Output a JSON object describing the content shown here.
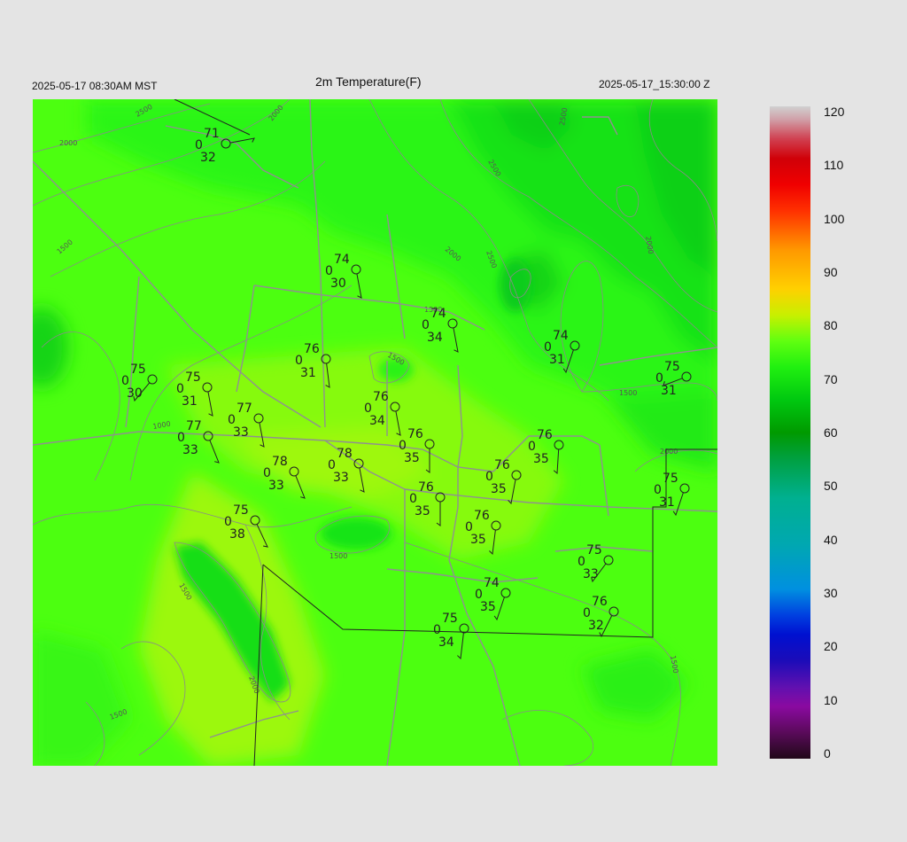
{
  "header": {
    "local_time": "2025-05-17 08:30AM MST",
    "title": "2m Temperature(F)",
    "utc_time": "2025-05-17_15:30:00 Z"
  },
  "colorbar": {
    "labels": [
      "120",
      "110",
      "100",
      "90",
      "80",
      "70",
      "60",
      "50",
      "40",
      "30",
      "20",
      "10",
      "0"
    ],
    "min": 0,
    "max": 120
  },
  "contour_labels": [
    "2500",
    "2000",
    "2000",
    "2500",
    "2500",
    "2000",
    "2500",
    "2000",
    "1500",
    "1500",
    "1500",
    "1000",
    "1500",
    "2000",
    "1500",
    "1500",
    "2000",
    "1500",
    "1500"
  ],
  "stations": [
    {
      "temp": "71",
      "dew": "32",
      "cloud": "0"
    },
    {
      "temp": "74",
      "dew": "30",
      "cloud": "0"
    },
    {
      "temp": "74",
      "dew": "34",
      "cloud": "0"
    },
    {
      "temp": "74",
      "dew": "31",
      "cloud": "0"
    },
    {
      "temp": "76",
      "dew": "31",
      "cloud": "0"
    },
    {
      "temp": "75",
      "dew": "30",
      "cloud": "0"
    },
    {
      "temp": "75",
      "dew": "31",
      "cloud": "0"
    },
    {
      "temp": "77",
      "dew": "33",
      "cloud": "0"
    },
    {
      "temp": "77",
      "dew": "33",
      "cloud": "0"
    },
    {
      "temp": "76",
      "dew": "34",
      "cloud": "0"
    },
    {
      "temp": "75",
      "dew": "31",
      "cloud": "0"
    },
    {
      "temp": "76",
      "dew": "35",
      "cloud": "0"
    },
    {
      "temp": "76",
      "dew": "35",
      "cloud": "0"
    },
    {
      "temp": "78",
      "dew": "33",
      "cloud": "0"
    },
    {
      "temp": "78",
      "dew": "33",
      "cloud": "0"
    },
    {
      "temp": "76",
      "dew": "35",
      "cloud": "0"
    },
    {
      "temp": "76",
      "dew": "35",
      "cloud": "0"
    },
    {
      "temp": "75",
      "dew": "31",
      "cloud": "0"
    },
    {
      "temp": "75",
      "dew": "38",
      "cloud": "0"
    },
    {
      "temp": "76",
      "dew": "35",
      "cloud": "0"
    },
    {
      "temp": "75",
      "dew": "33",
      "cloud": "0"
    },
    {
      "temp": "74",
      "dew": "35",
      "cloud": "0"
    },
    {
      "temp": "76",
      "dew": "32",
      "cloud": "0"
    },
    {
      "temp": "75",
      "dew": "34",
      "cloud": "0"
    }
  ],
  "colors": {
    "background": "#e4e4e4",
    "field_base": "#4cff10",
    "field_warm": "#a6f80a",
    "field_cool": "#1ee616",
    "contour": "#8a8a8a",
    "county_line": "#909090",
    "boundary": "#222222"
  }
}
